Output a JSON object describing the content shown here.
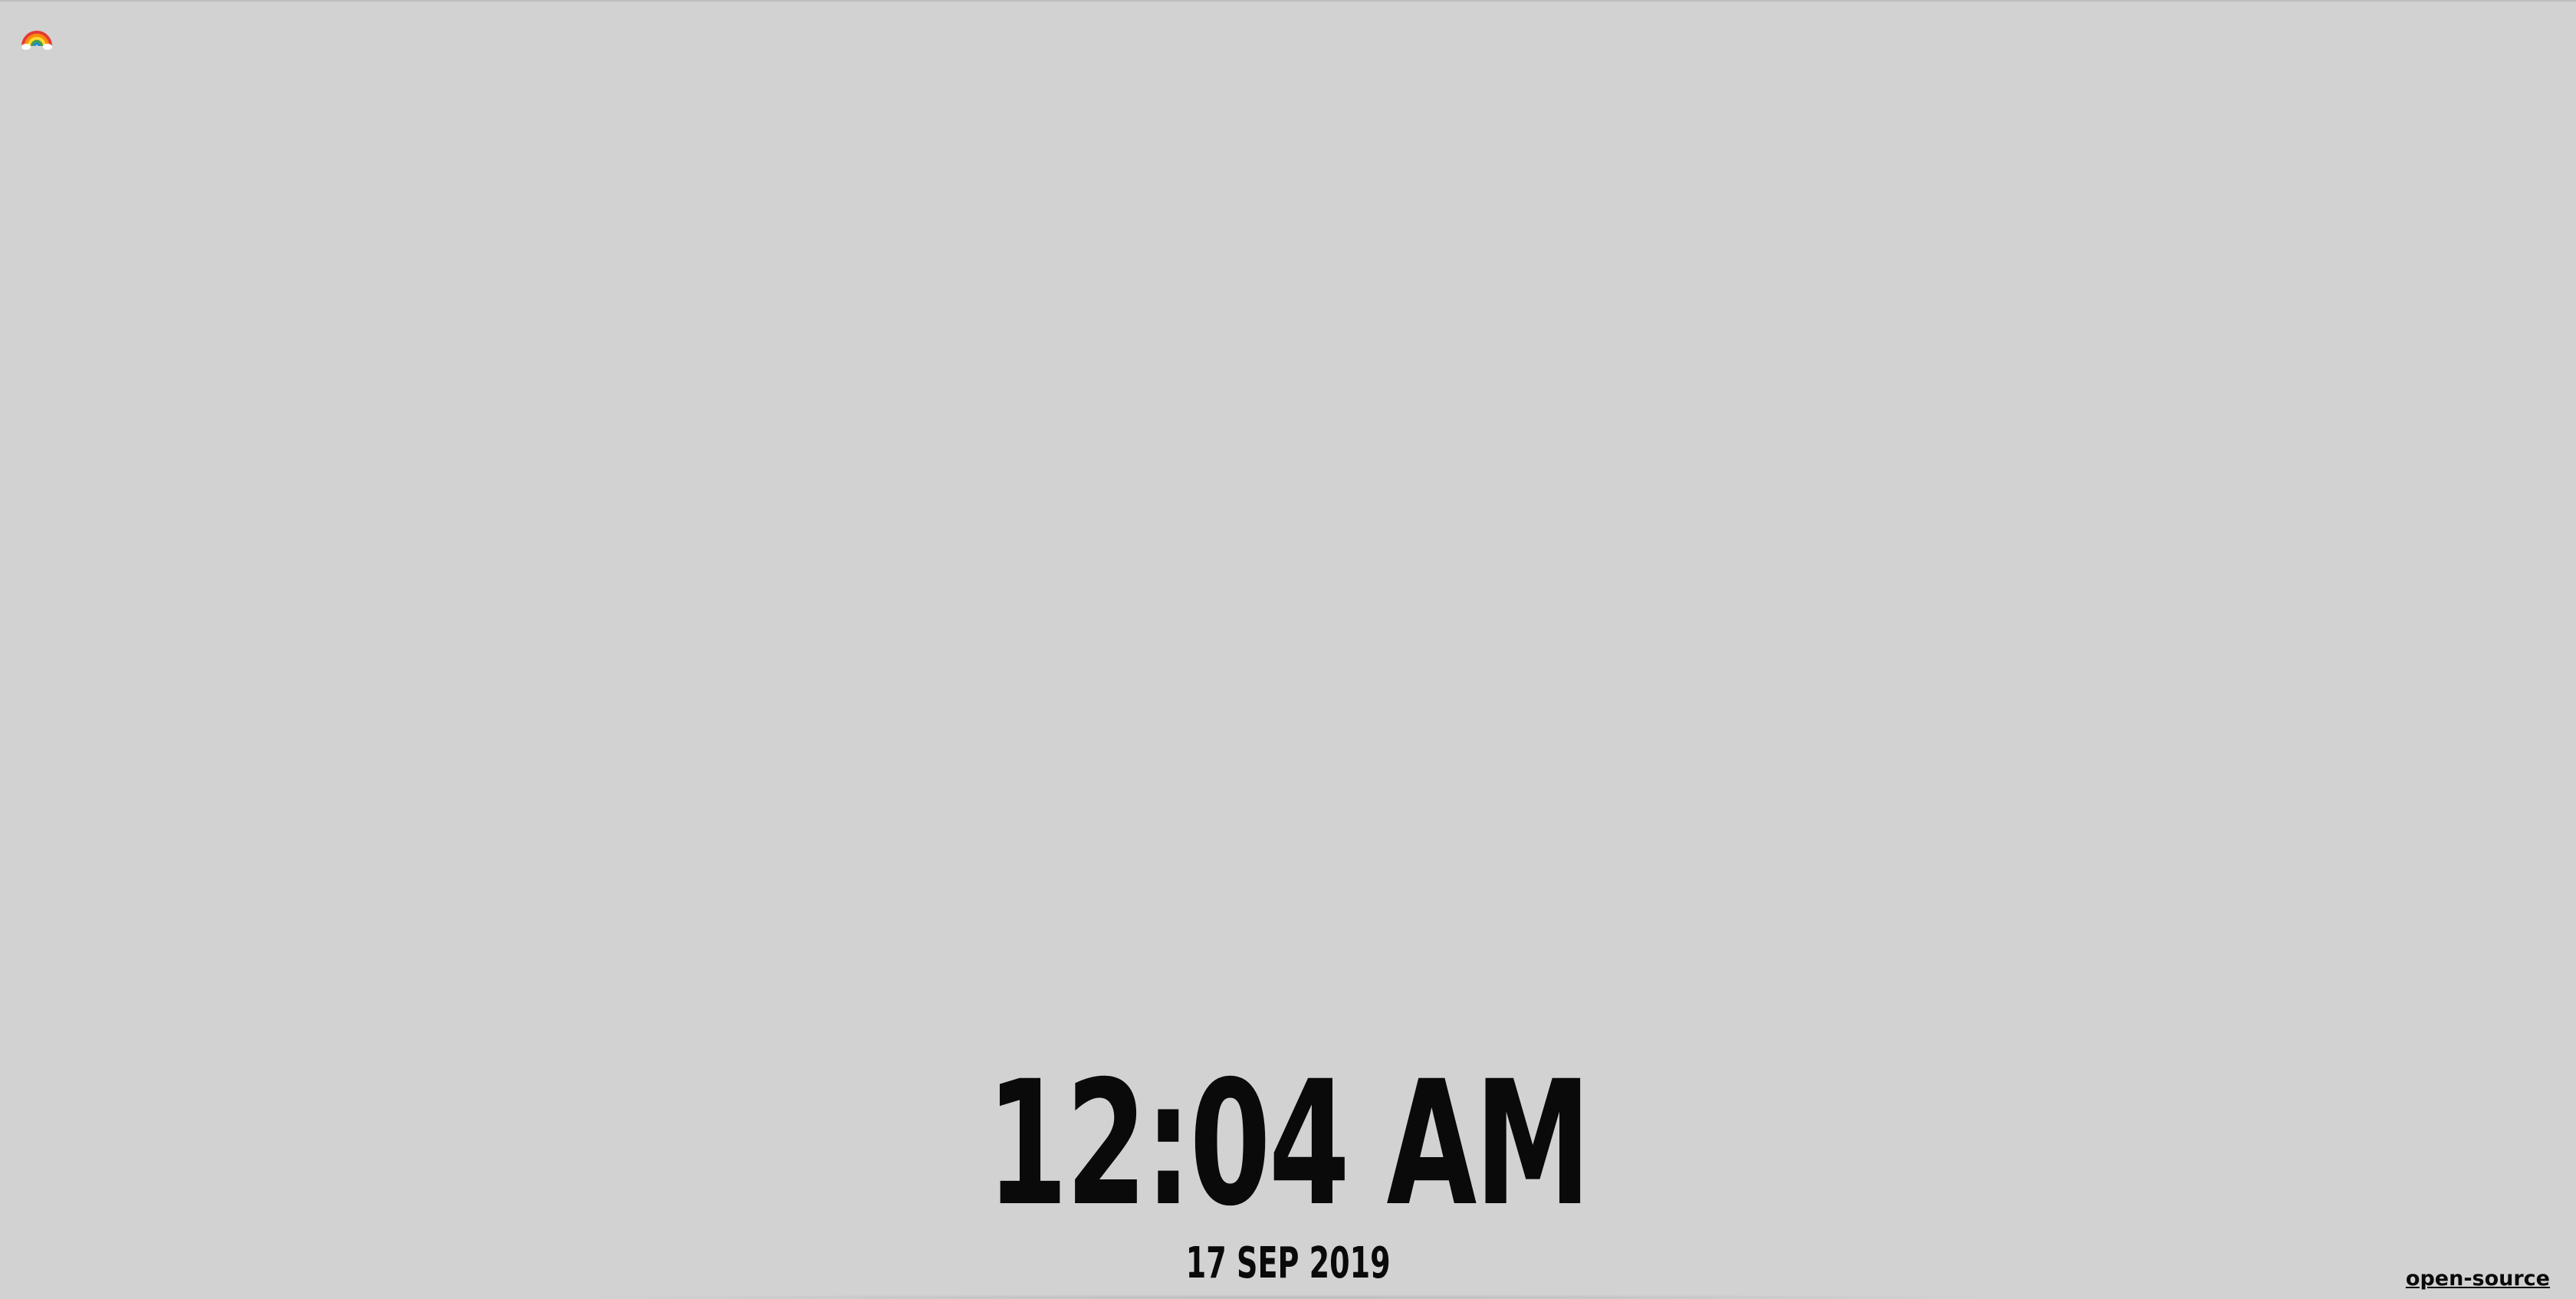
{
  "header": {
    "theme_toggle_icon": "rainbow-icon"
  },
  "clock": {
    "time": "12:04 AM",
    "date": "17 SEP 2019"
  },
  "footer": {
    "source_link": "open-source"
  },
  "colors": {
    "background": "#d2d2d2",
    "text": "#0a0a0a"
  }
}
